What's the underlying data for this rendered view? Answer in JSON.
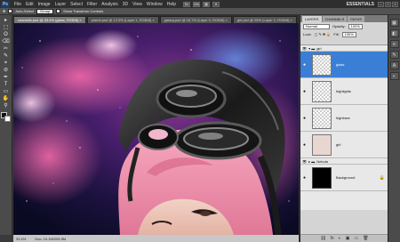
{
  "app": {
    "logo": "Ps",
    "workspace": "ESSENTIALS"
  },
  "menu": [
    "File",
    "Edit",
    "Image",
    "Layer",
    "Select",
    "Filter",
    "Analysis",
    "3D",
    "View",
    "Window",
    "Help"
  ],
  "title_tools": [
    "Br",
    "Mb",
    "▦",
    "▾"
  ],
  "window_buttons": [
    "–",
    "□",
    "×"
  ],
  "options_bar": {
    "auto_select_label": "Auto-Select",
    "auto_select_value": "Group",
    "transform_label": "Show Transform Controls"
  },
  "document_tabs": [
    {
      "label": "cosmetic.psd @ 33.4% (glass, RGB/8) ×",
      "active": true
    },
    {
      "label": "planet.psd @ 12.5% (Layer 1, RGB/8) ×",
      "active": false
    },
    {
      "label": "galaxy.psd @ 16.7% (Layer 0, RGB/8) ×",
      "active": false
    },
    {
      "label": "girl.psd @ 25% (Layer 2, RGB/8) ×",
      "active": false
    }
  ],
  "status_bar": {
    "zoom": "33.4%",
    "doc_size": "Doc: 24.1M/205.5M"
  },
  "panel": {
    "tabs": [
      "LAYERS",
      "CHANNELS",
      "PATHS"
    ],
    "blend_mode": "Normal",
    "opacity_label": "Opacity:",
    "opacity_value": "100%",
    "lock_label": "Lock:",
    "fill_label": "Fill:",
    "fill_value": "100%",
    "group_name": "girl",
    "layers": [
      {
        "name": "glass",
        "selected": true,
        "thumb": "transparent"
      },
      {
        "name": "highlights",
        "selected": false,
        "thumb": "transparent"
      },
      {
        "name": "highlows",
        "selected": false,
        "thumb": "transparent"
      },
      {
        "name": "girl",
        "selected": false,
        "thumb": "face"
      }
    ],
    "group2_name": "Nebula",
    "background_layer": "Background",
    "bottom_icons": [
      "⛓",
      "fx",
      "◐",
      "▣",
      "▭",
      "🗑"
    ]
  },
  "dock_icons": [
    "▦",
    "◧",
    "≡",
    "✎",
    "A",
    "◐"
  ],
  "tools": [
    "▸",
    "⬚",
    "ʘ",
    "⌫",
    "✂",
    "✎",
    "⌖",
    "⊘",
    "✒",
    "T",
    "▭",
    "✋",
    "⚲"
  ]
}
